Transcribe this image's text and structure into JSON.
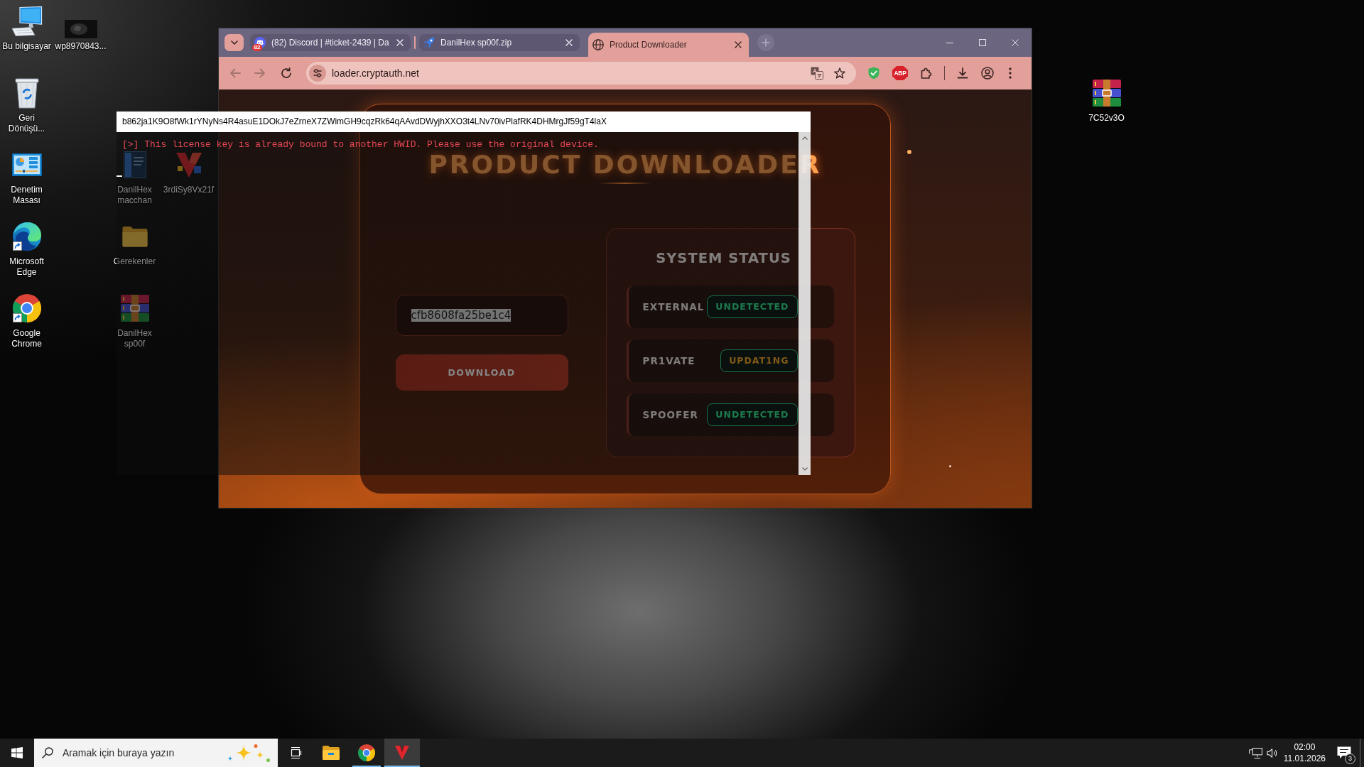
{
  "desktop": {
    "icon_columns": [
      [
        {
          "label": "Bu bilgisayar",
          "kind": "computer",
          "shortcut": false
        },
        {
          "label": "Geri Dönüşü...",
          "kind": "recycle_bin",
          "shortcut": false
        },
        {
          "label": "Denetim Masası",
          "kind": "control_panel",
          "shortcut": false
        },
        {
          "label": "Microsoft Edge",
          "kind": "edge",
          "shortcut": true
        },
        {
          "label": "Google Chrome",
          "kind": "chrome",
          "shortcut": true
        }
      ],
      [
        {
          "label": "wp8970843...",
          "kind": "image",
          "shortcut": false
        }
      ],
      [
        {
          "label": "DanilHex macchan",
          "kind": "document",
          "shortcut": false
        },
        {
          "label": "Gerekenler",
          "kind": "folder",
          "shortcut": false
        },
        {
          "label": "DanilHex sp00f",
          "kind": "archive",
          "shortcut": false
        }
      ],
      [
        {
          "label": "3rdiSy8Vx21f",
          "kind": "app",
          "shortcut": false
        }
      ]
    ],
    "right_icons": [
      {
        "label": "7C52v3O",
        "kind": "archive",
        "shortcut": false
      }
    ]
  },
  "browser": {
    "tabs": [
      {
        "title": "(82) Discord | #ticket-2439 | Da",
        "kind": "chat",
        "badge": "82",
        "selected": false
      },
      {
        "title": "DanilHex sp00f.zip",
        "kind": "rocket",
        "selected": false
      },
      {
        "title": "Product Downloader",
        "kind": "globe",
        "selected": true
      }
    ],
    "toolbar": {
      "back": {
        "disabled": true
      },
      "forward": {
        "disabled": true
      },
      "url": "loader.cryptauth.net",
      "extensions": [
        {
          "kind": "shield"
        },
        {
          "kind": "adblock",
          "label": "ABP"
        },
        {
          "kind": "puzzle"
        }
      ]
    },
    "page": {
      "title": "PRODUCT DOWNLOADER",
      "key_field": {
        "value": "cfb8608fa25be1c4",
        "text_selected": true
      },
      "download_button": {
        "label": "DOWNLOAD"
      },
      "status_panel": {
        "title": "SYSTEM STATUS",
        "rows": [
          {
            "name": "EXTERNAL",
            "status": "UNDETECTED",
            "kind": "ok"
          },
          {
            "name": "PR1VATE",
            "status": "UPDAT1NG",
            "kind": "warn"
          },
          {
            "name": "SPOOFER",
            "status": "UNDETECTED",
            "kind": "ok"
          }
        ]
      }
    }
  },
  "console": {
    "title": "b862ja1K9O8fWk1rYNyNs4R4asuE1DOkJ7eZrneX7ZWimGH9cqzRk64qAAvdDWyjhXXO3t4LNv70ivPlafRK4DHMrgJf59gT4laX",
    "lines": [
      {
        "text": "[>] This license key is already bound to another HWID. Please use the original device.",
        "kind": "error"
      }
    ]
  },
  "taskbar": {
    "search": {
      "placeholder": "Aramak için buraya yazın"
    },
    "apps": [
      {
        "kind": "task_view",
        "running": false,
        "active": false
      },
      {
        "kind": "explorer",
        "running": false,
        "active": false
      },
      {
        "kind": "chrome",
        "running": true,
        "active": false
      },
      {
        "kind": "app",
        "running": true,
        "active": true
      }
    ],
    "clock": {
      "time": "02:00",
      "date": "11.01.2026"
    },
    "notifications": {
      "count": "3"
    }
  }
}
